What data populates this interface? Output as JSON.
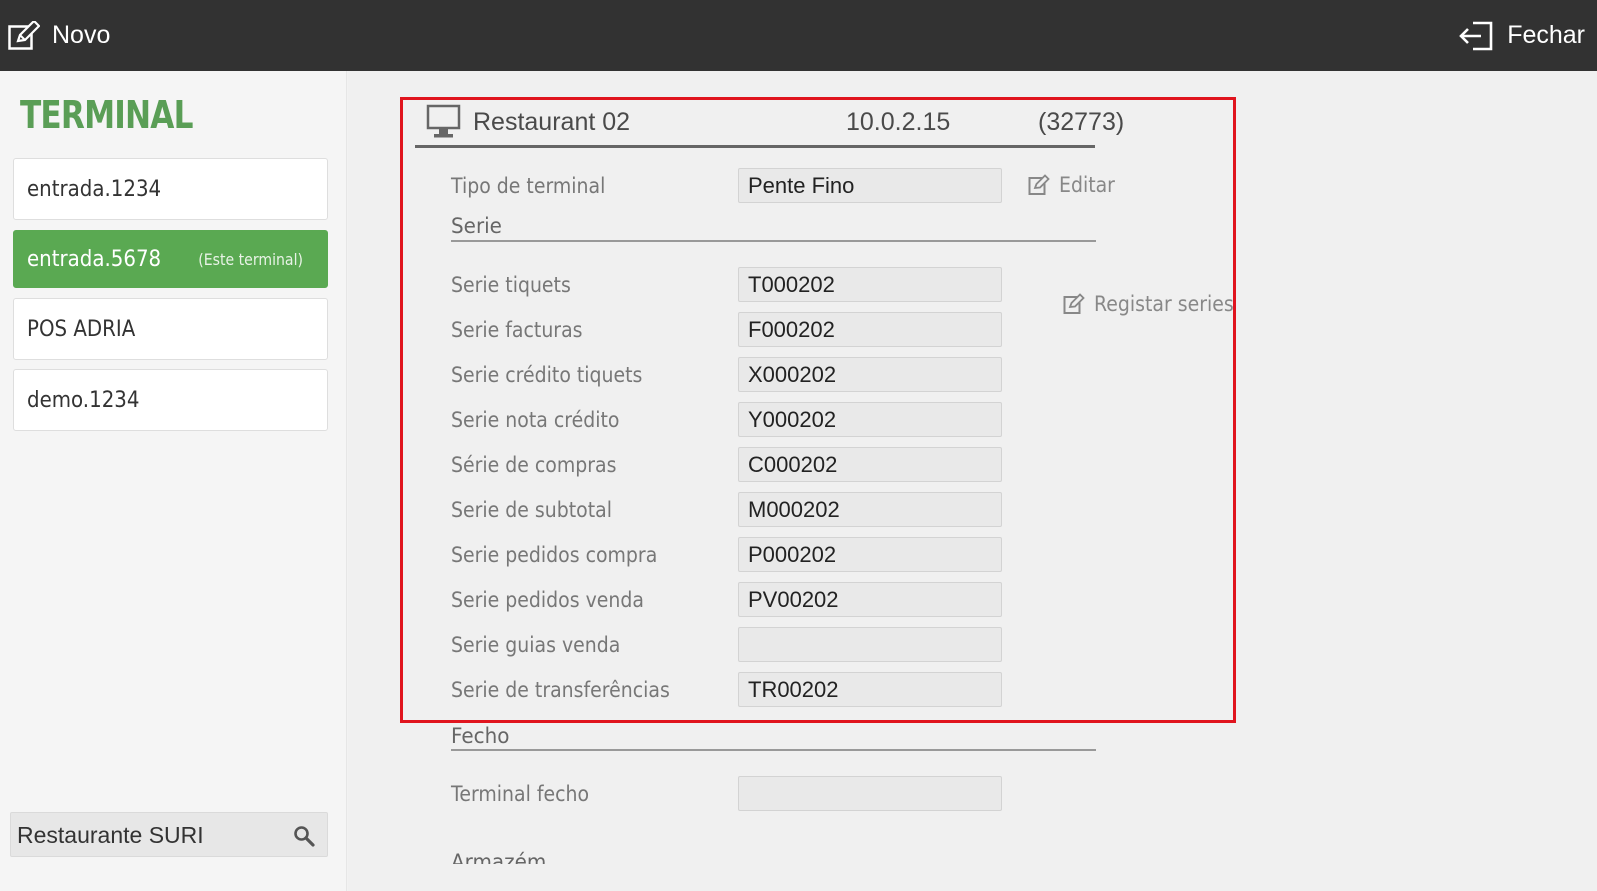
{
  "topbar": {
    "new_label": "Novo",
    "close_label": "Fechar"
  },
  "sidebar": {
    "title": "TERMINAL",
    "items": [
      {
        "label": "entrada.1234",
        "note": ""
      },
      {
        "label": "entrada.5678",
        "note": "(Este terminal)"
      },
      {
        "label": "POS ADRIA",
        "note": ""
      },
      {
        "label": "demo.1234",
        "note": ""
      }
    ],
    "selected_index": 1,
    "search_value": "Restaurante SURI"
  },
  "terminal": {
    "name": "Restaurant 02",
    "ip": "10.0.2.15",
    "port": "(32773)"
  },
  "form": {
    "type_label": "Tipo de terminal",
    "type_value": "Pente Fino",
    "edit_label": "Editar",
    "serie_section": "Serie",
    "register_label": "Registar series",
    "series": [
      {
        "label": "Serie tiquets",
        "value": "T000202"
      },
      {
        "label": "Serie facturas",
        "value": "F000202"
      },
      {
        "label": "Serie crédito tiquets",
        "value": "X000202"
      },
      {
        "label": "Serie nota crédito",
        "value": "Y000202"
      },
      {
        "label": "Série de compras",
        "value": "C000202"
      },
      {
        "label": "Serie de subtotal",
        "value": "M000202"
      },
      {
        "label": "Serie pedidos compra",
        "value": "P000202"
      },
      {
        "label": "Serie pedidos venda",
        "value": "PV00202"
      },
      {
        "label": "Serie guias venda",
        "value": ""
      },
      {
        "label": "Serie de transferências",
        "value": "TR00202"
      }
    ],
    "fecho_section": "Fecho",
    "fecho_label": "Terminal fecho",
    "fecho_value": "",
    "armazem_section": "Armazém"
  },
  "colors": {
    "topbar": "#323232",
    "accent_green": "#5aa952",
    "highlight_red": "#e0141e"
  }
}
